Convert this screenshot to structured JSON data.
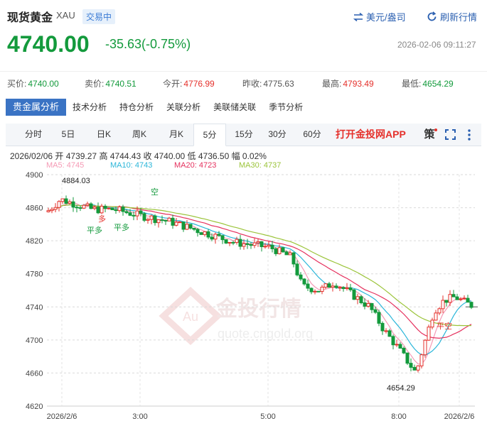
{
  "header": {
    "title": "现货黄金",
    "code": "XAU",
    "status": "交易中",
    "unit_toggle": "美元/盎司",
    "refresh": "刷新行情"
  },
  "price": {
    "last": "4740.00",
    "change": "-35.63(-0.75%)",
    "timestamp": "2026-02-06 09:11:27"
  },
  "quotes": [
    {
      "label": "买价:",
      "value": "4740.00",
      "color": "green"
    },
    {
      "label": "卖价:",
      "value": "4740.51",
      "color": "green"
    },
    {
      "label": "今开:",
      "value": "4776.99",
      "color": "red"
    },
    {
      "label": "昨收:",
      "value": "4775.63",
      "color": "gray"
    },
    {
      "label": "最高:",
      "value": "4793.49",
      "color": "red"
    },
    {
      "label": "最低:",
      "value": "4654.29",
      "color": "green"
    }
  ],
  "analysis_tabs": [
    "贵金属分析",
    "技术分析",
    "持仓分析",
    "关联分析",
    "美联储关联",
    "季节分析"
  ],
  "period_tabs": [
    "分时",
    "5日",
    "日K",
    "周K",
    "月K",
    "5分",
    "15分",
    "30分",
    "60分"
  ],
  "active_period": "5分",
  "promo": "打开金投网APP",
  "strategy_label": "策",
  "ohlc": "2026/02/06  开 4739.27  高 4744.43  收 4740.00  低 4736.50  幅 0.02%",
  "ma_legend": [
    {
      "label": "MA5: 4745",
      "color": "#f59ab5"
    },
    {
      "label": "MA10: 4743",
      "color": "#2bb6d9"
    },
    {
      "label": "MA20: 4723",
      "color": "#e5315e"
    },
    {
      "label": "MA30: 4737",
      "color": "#9bc43a"
    }
  ],
  "watermark": {
    "brand": "金投行情",
    "url": "quote.cngold.org"
  },
  "chart_data": {
    "type": "candlestick",
    "y_ticks": [
      4900,
      4860,
      4820,
      4780,
      4740,
      4700,
      4660,
      4620
    ],
    "ylim": [
      4620,
      4900
    ],
    "x_ticks": [
      "2026/2/6",
      "3:00",
      "5:00",
      "8:00",
      "2026/2/6"
    ],
    "annotations": [
      {
        "text": "4884.03",
        "kind": "high"
      },
      {
        "text": "4654.29",
        "kind": "low"
      },
      {
        "text": "平多"
      },
      {
        "text": "多"
      },
      {
        "text": "平多"
      },
      {
        "text": "空"
      },
      {
        "text": "平空"
      }
    ],
    "last_price": 4740.0
  }
}
